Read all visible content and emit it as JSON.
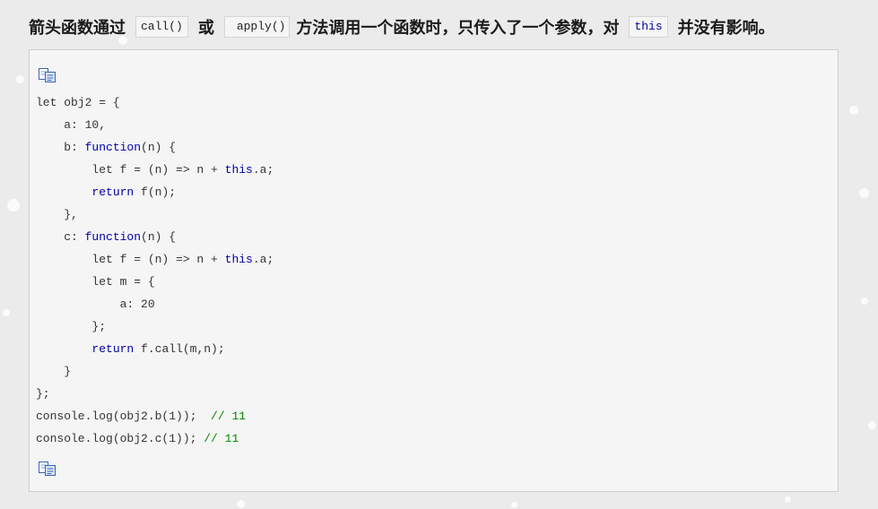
{
  "heading": {
    "part1": "箭头函数通过",
    "chip1": "call()",
    "part2": "或",
    "chip2": "apply()",
    "part3": "方法调用一个函数时，只传入了一个参数，对",
    "chip3": "this",
    "part4": "并没有影响。"
  },
  "code": {
    "copy_icon": "copy-icon",
    "lines": [
      [
        {
          "t": "let obj2 = {"
        }
      ],
      [
        {
          "t": "    a: 10,"
        }
      ],
      [
        {
          "t": "    b: "
        },
        {
          "t": "function",
          "c": "k"
        },
        {
          "t": "(n) {"
        }
      ],
      [
        {
          "t": "        let f = (n) => n + "
        },
        {
          "t": "this",
          "c": "k"
        },
        {
          "t": ".a;"
        }
      ],
      [
        {
          "t": "        "
        },
        {
          "t": "return",
          "c": "k"
        },
        {
          "t": " f(n);"
        }
      ],
      [
        {
          "t": "    },"
        }
      ],
      [
        {
          "t": "    c: "
        },
        {
          "t": "function",
          "c": "k"
        },
        {
          "t": "(n) {"
        }
      ],
      [
        {
          "t": "        let f = (n) => n + "
        },
        {
          "t": "this",
          "c": "k"
        },
        {
          "t": ".a;"
        }
      ],
      [
        {
          "t": "        let m = {"
        }
      ],
      [
        {
          "t": "            a: 20"
        }
      ],
      [
        {
          "t": "        };"
        }
      ],
      [
        {
          "t": "        "
        },
        {
          "t": "return",
          "c": "k"
        },
        {
          "t": " f.call(m,n);"
        }
      ],
      [
        {
          "t": "    }"
        }
      ],
      [
        {
          "t": "};"
        }
      ],
      [
        {
          "t": "console.log(obj2.b(1));  "
        },
        {
          "t": "// 11",
          "c": "c"
        }
      ],
      [
        {
          "t": "console.log(obj2.c(1)); "
        },
        {
          "t": "// 11",
          "c": "c"
        }
      ]
    ]
  },
  "colors": {
    "keyword": "#0000aa",
    "comment": "#008800",
    "code_bg": "#f5f5f5",
    "page_bg": "#ebebeb"
  }
}
